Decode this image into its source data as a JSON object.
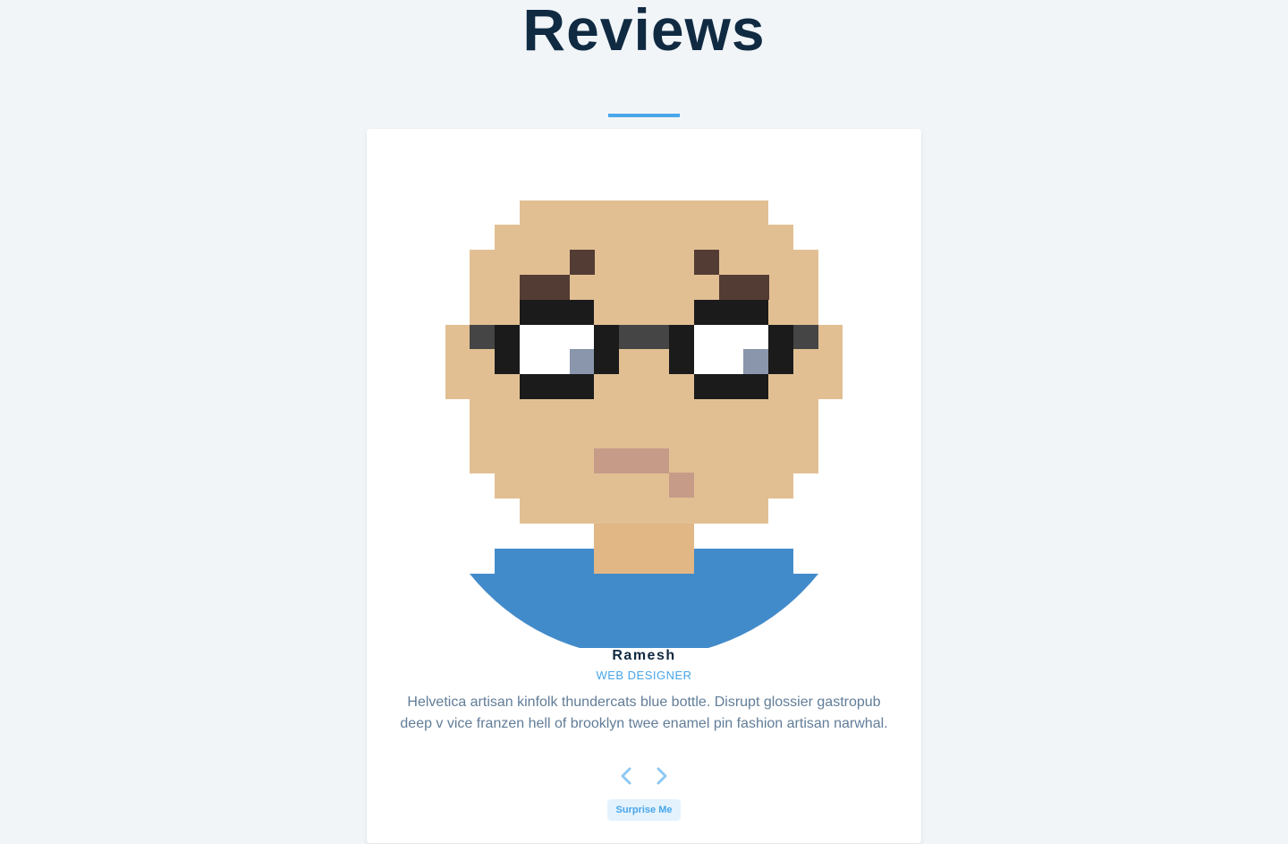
{
  "page": {
    "title": "Reviews"
  },
  "review": {
    "name": "Ramesh",
    "job": "Web Designer",
    "text": "Helvetica artisan kinfolk thundercats blue bottle. Disrupt glossier gastropub deep v vice franzen hell of brooklyn twee enamel pin fashion artisan narwhal.",
    "avatar": "pixel-art-person-with-glasses"
  },
  "controls": {
    "prev_icon": "chevron-left-icon",
    "next_icon": "chevron-right-icon",
    "random_label": "Surprise Me"
  },
  "colors": {
    "title": "#102a42",
    "accent": "#49a6e9",
    "text": "#617d98",
    "background": "#f1f5f8",
    "card": "#ffffff"
  }
}
